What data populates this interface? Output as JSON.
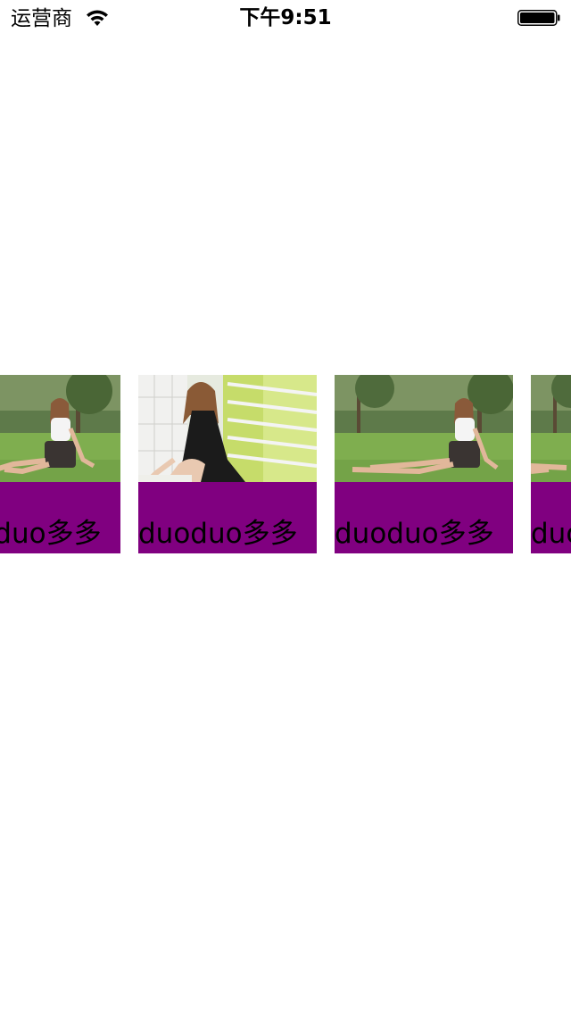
{
  "status_bar": {
    "carrier": "运营商",
    "time": "下午9:51",
    "wifi_icon": "wifi-icon",
    "battery_icon": "battery-icon"
  },
  "carousel": {
    "caption_color": "#800080",
    "items": [
      {
        "caption": "duoduo多多",
        "photo": "photo-woman-sitting-on-grass"
      },
      {
        "caption": "duoduo多多",
        "photo": "photo-woman-in-black-dress"
      },
      {
        "caption": "duoduo多多",
        "photo": "photo-woman-sitting-on-grass"
      },
      {
        "caption": "duoduo多多",
        "photo": "photo-woman-sitting-on-grass"
      }
    ]
  }
}
